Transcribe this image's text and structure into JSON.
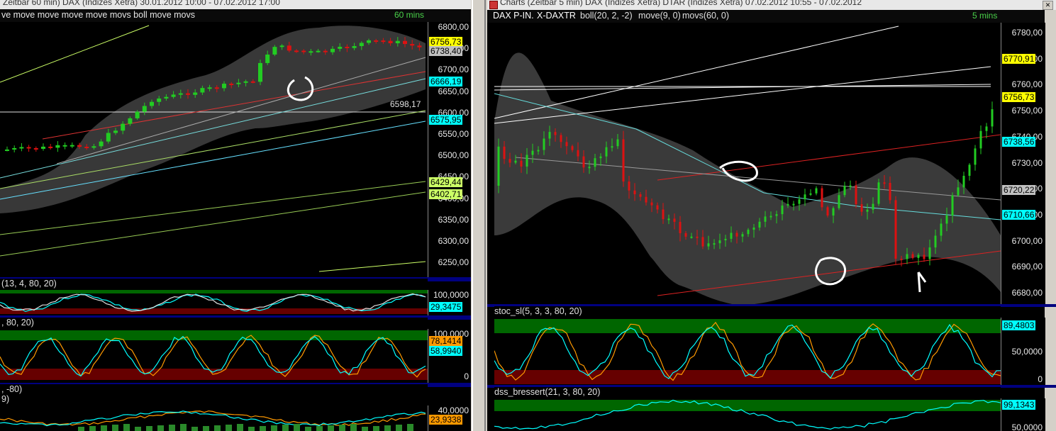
{
  "left_window": {
    "title": "Zeitbar 60 min) DAX (Indizes Xetra) 30.01.2012 10:00 - 07.02.2012 17:00",
    "header_label": "ve move move move move movs boll move movs",
    "interval": "60 mins",
    "price_ticks": [
      "6800,00",
      "6750,00",
      "6700,00",
      "6650,00",
      "6600,00",
      "6550,00",
      "6500,00",
      "6450,00",
      "6400,00",
      "6350,00",
      "6300,00",
      "6250,00"
    ],
    "markers": [
      {
        "text": "6756,73",
        "bg": "#ffff00"
      },
      {
        "text": "6738,40",
        "bg": "#c0c0c0"
      },
      {
        "text": "6666,19",
        "bg": "#00ffff"
      },
      {
        "text": "6575,95",
        "bg": "#00ffff"
      },
      {
        "text": "6429,44",
        "bg": "#ccff66"
      },
      {
        "text": "6402,71",
        "bg": "#ccff66"
      }
    ],
    "level_label": "6598,17",
    "stoch1": {
      "label": "(13, 4, 80, 20)",
      "ticks": [
        "100,0000"
      ],
      "marker": "29,3475"
    },
    "stoch2": {
      "label": ", 80, 20)",
      "ticks": [
        "100,0000",
        "0"
      ],
      "markers": [
        "78,1414",
        "58,9940"
      ]
    },
    "dss": {
      "label1": ", -80)",
      "label2": "9)",
      "ticks": [
        "40,0000"
      ],
      "marker": "23,9338"
    }
  },
  "right_window": {
    "title": "Charts (Zeitbar 5 min) DAX (Indizes Xetra) DTAR (Indizes Xetra) 07.02.2012 10:55 - 07.02.2012",
    "header_parts": [
      {
        "text": "DAX P-IN.",
        "color": "#ffffff"
      },
      {
        "text": "X-DAXTR",
        "color": "#ffffff"
      },
      {
        "text": "boll(20, 2, -2)",
        "color": "#e0e0e0"
      },
      {
        "text": "move(9, 0)",
        "color": "#e0e0e0"
      },
      {
        "text": "movs(60, 0)",
        "color": "#e0e0e0"
      }
    ],
    "interval": "5 mins",
    "price_ticks": [
      "6780,00",
      "6770,00",
      "6760,00",
      "6750,00",
      "6740,00",
      "6730,00",
      "6720,00",
      "6710,00",
      "6700,00",
      "6690,00",
      "6680,00"
    ],
    "markers": [
      {
        "text": "6770,91",
        "bg": "#ffff00"
      },
      {
        "text": "6756,73",
        "bg": "#ffff00"
      },
      {
        "text": "6738,56",
        "bg": "#00ffff"
      },
      {
        "text": "6720,22",
        "bg": "#c0c0c0"
      },
      {
        "text": "6710,66",
        "bg": "#00ffff"
      }
    ],
    "stoch": {
      "label": "stoc_sl(5, 3, 3, 80, 20)",
      "ticks": [
        "50,0000",
        "0"
      ],
      "marker": "89,4803"
    },
    "dss": {
      "label": "dss_bressert(21, 3, 80, 20)",
      "ticks": [
        "50,0000"
      ],
      "marker": "99,1343"
    }
  },
  "colors": {
    "bull": "#22cc22",
    "bear": "#dd1111",
    "band": "#3a3a3a",
    "accent": "#49d149"
  }
}
